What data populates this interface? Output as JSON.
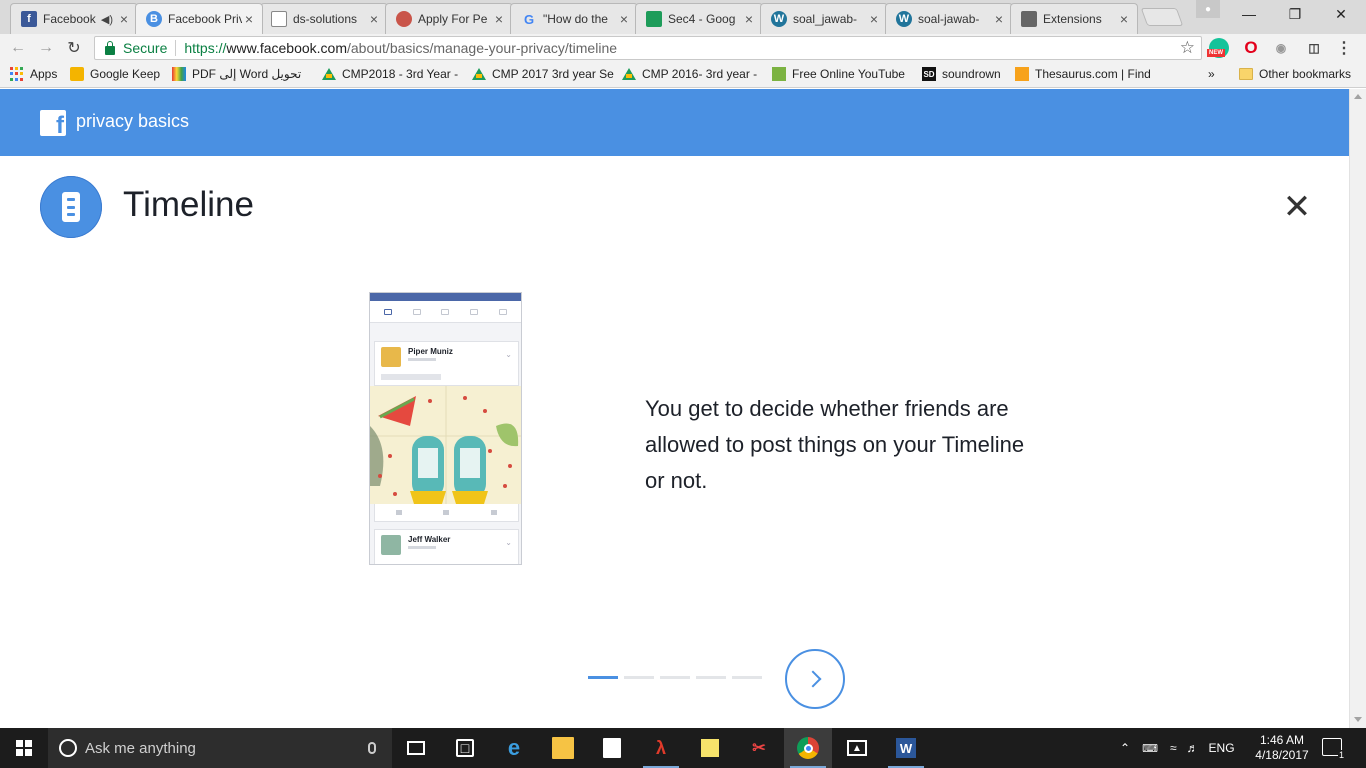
{
  "tabs": [
    {
      "title": "Facebook",
      "icon": "facebook-icon",
      "color": "#3b5998",
      "glyph": "f",
      "audio": true
    },
    {
      "title": "Facebook Privacy",
      "icon": "privacy-basics-icon",
      "color": "#4a90e2",
      "glyph": "B",
      "active": true
    },
    {
      "title": "ds-solutions",
      "icon": "document-icon",
      "color": "#ffffff",
      "glyph": ""
    },
    {
      "title": "Apply For Pe",
      "icon": "globe-icon",
      "color": "#c9554a",
      "glyph": ""
    },
    {
      "title": "\"How do the",
      "icon": "google-icon",
      "color": "#ffffff",
      "glyph": "G"
    },
    {
      "title": "Sec4 - Goog",
      "icon": "google-drive-icon",
      "color": "#1e9c5a",
      "glyph": ""
    },
    {
      "title": "soal_jawab-",
      "icon": "wordpress-icon",
      "color": "#21759b",
      "glyph": "W"
    },
    {
      "title": "soal-jawab-",
      "icon": "wordpress-icon",
      "color": "#21759b",
      "glyph": "W"
    },
    {
      "title": "Extensions",
      "icon": "puzzle-icon",
      "color": "#666666",
      "glyph": ""
    }
  ],
  "omnibox": {
    "secure_label": "Secure",
    "url_proto": "https://",
    "url_host": "www.facebook.com",
    "url_path": "/about/basics/manage-your-privacy/timeline"
  },
  "extensions": {
    "new_badge": "NEW"
  },
  "bookmarks": [
    {
      "label": "Apps",
      "icon": "apps-grid-icon"
    },
    {
      "label": "Google Keep",
      "icon": "google-keep-icon",
      "color": "#f4b400"
    },
    {
      "label": "تحويل Word إلى PDF",
      "icon": "colorful-squares-icon",
      "color": "#7b3fd1"
    },
    {
      "label": "CMP2018 - 3rd Year -",
      "icon": "google-drive-icon"
    },
    {
      "label": "CMP 2017 3rd year Se",
      "icon": "google-drive-icon"
    },
    {
      "label": "CMP 2016- 3rd year -",
      "icon": "google-drive-icon"
    },
    {
      "label": "Free Online YouTube",
      "icon": "download-arrow-icon",
      "color": "#7cb342"
    },
    {
      "label": "soundrown",
      "icon": "soundrown-icon",
      "color": "#111111",
      "glyph": "SD"
    },
    {
      "label": "Thesaurus.com | Find",
      "icon": "thesaurus-icon",
      "color": "#f7a21b"
    }
  ],
  "bookmarks_overflow": "»",
  "other_bookmarks": "Other bookmarks",
  "page": {
    "brand": "privacy basics",
    "topic_title": "Timeline",
    "description": "You get to decide whether friends are allowed to post things on your Timeline or not.",
    "mock_posts": [
      {
        "name": "Piper Muniz"
      },
      {
        "name": "Jeff Walker"
      }
    ],
    "pager": {
      "total": 5,
      "current": 1
    },
    "colors": {
      "accent": "#4a90e2",
      "header": "#4a90e2",
      "text": "#1d2129"
    }
  },
  "taskbar": {
    "search_placeholder": "Ask me anything",
    "language": "ENG",
    "time": "1:46 AM",
    "date": "4/18/2017",
    "notification_count": "1"
  }
}
